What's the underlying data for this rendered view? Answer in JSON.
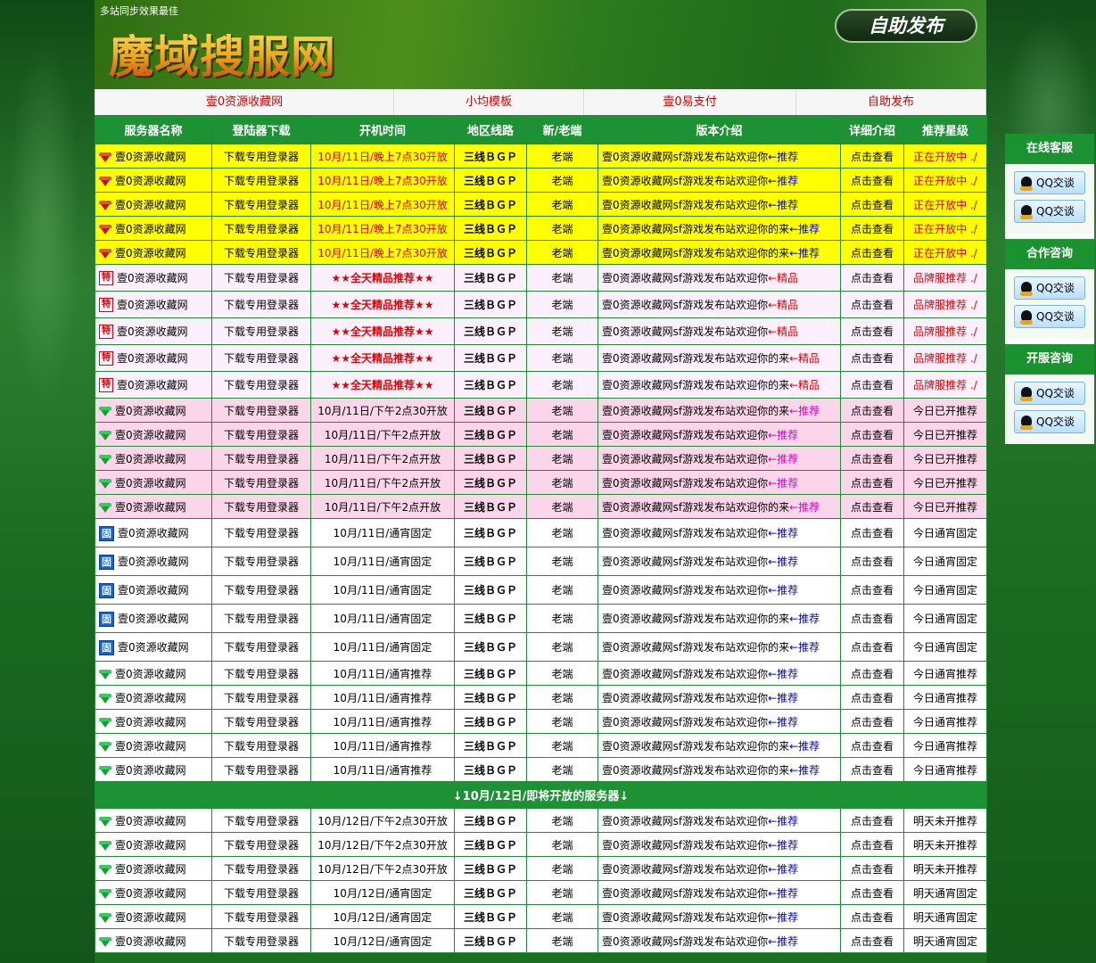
{
  "header": {
    "tagline": "多站同步效果最佳",
    "logo": "魔域搜服网",
    "publish_button": "自助发布"
  },
  "nav": [
    "壹0资源收藏网",
    "小均模板",
    "壹0易支付",
    "自助发布"
  ],
  "table": {
    "headers": [
      "服务器名称",
      "登陆器下载",
      "开机时间",
      "地区线路",
      "新/老端",
      "版本介绍",
      "详细介绍",
      "推荐星级"
    ],
    "rows": [
      {
        "style": "yellow",
        "icon": "gem-red",
        "name": "壹0资源收藏网",
        "download": "下载专用登录器",
        "time": "10月/11日/晚上7点30开放",
        "line": "三线ＢＧＰ",
        "type": "老端",
        "intro": "壹0资源收藏网sf游戏发布站欢迎你",
        "tag": "←推荐",
        "detail": "点击查看",
        "star": "正在开放中 ./"
      },
      {
        "style": "yellow",
        "icon": "gem-red",
        "name": "壹0资源收藏网",
        "download": "下载专用登录器",
        "time": "10月/11日/晚上7点30开放",
        "line": "三线ＢＧＰ",
        "type": "老端",
        "intro": "壹0资源收藏网sf游戏发布站欢迎你",
        "tag": "←推荐",
        "detail": "点击查看",
        "star": "正在开放中 ./"
      },
      {
        "style": "yellow",
        "icon": "gem-red",
        "name": "壹0资源收藏网",
        "download": "下载专用登录器",
        "time": "10月/11日/晚上7点30开放",
        "line": "三线ＢＧＰ",
        "type": "老端",
        "intro": "壹0资源收藏网sf游戏发布站欢迎你",
        "tag": "←推荐",
        "detail": "点击查看",
        "star": "正在开放中 ./"
      },
      {
        "style": "yellow",
        "icon": "gem-red",
        "name": "壹0资源收藏网",
        "download": "下载专用登录器",
        "time": "10月/11日/晚上7点30开放",
        "line": "三线ＢＧＰ",
        "type": "老端",
        "intro": "壹0资源收藏网sf游戏发布站欢迎你的来",
        "tag": "←推荐",
        "detail": "点击查看",
        "star": "正在开放中 ./"
      },
      {
        "style": "yellow",
        "icon": "gem-red",
        "name": "壹0资源收藏网",
        "download": "下载专用登录器",
        "time": "10月/11日/晚上7点30开放",
        "line": "三线ＢＧＰ",
        "type": "老端",
        "intro": "壹0资源收藏网sf游戏发布站欢迎你的来",
        "tag": "←推荐",
        "detail": "点击查看",
        "star": "正在开放中 ./"
      },
      {
        "style": "lav",
        "icon": "box",
        "name": "壹0资源收藏网",
        "download": "下载专用登录器",
        "time": "★★全天精品推荐★★",
        "line": "三线ＢＧＰ",
        "type": "老端",
        "intro": "壹0资源收藏网sf游戏发布站欢迎你",
        "tag": "←精品",
        "detail": "点击查看",
        "star": "品牌服推荐 ./"
      },
      {
        "style": "lav",
        "icon": "box",
        "name": "壹0资源收藏网",
        "download": "下载专用登录器",
        "time": "★★全天精品推荐★★",
        "line": "三线ＢＧＰ",
        "type": "老端",
        "intro": "壹0资源收藏网sf游戏发布站欢迎你",
        "tag": "←精品",
        "detail": "点击查看",
        "star": "品牌服推荐 ./"
      },
      {
        "style": "lav",
        "icon": "box",
        "name": "壹0资源收藏网",
        "download": "下载专用登录器",
        "time": "★★全天精品推荐★★",
        "line": "三线ＢＧＰ",
        "type": "老端",
        "intro": "壹0资源收藏网sf游戏发布站欢迎你",
        "tag": "←精品",
        "detail": "点击查看",
        "star": "品牌服推荐 ./"
      },
      {
        "style": "lav",
        "icon": "box",
        "name": "壹0资源收藏网",
        "download": "下载专用登录器",
        "time": "★★全天精品推荐★★",
        "line": "三线ＢＧＰ",
        "type": "老端",
        "intro": "壹0资源收藏网sf游戏发布站欢迎你的来",
        "tag": "←精品",
        "detail": "点击查看",
        "star": "品牌服推荐 ./"
      },
      {
        "style": "lav",
        "icon": "box",
        "name": "壹0资源收藏网",
        "download": "下载专用登录器",
        "time": "★★全天精品推荐★★",
        "line": "三线ＢＧＰ",
        "type": "老端",
        "intro": "壹0资源收藏网sf游戏发布站欢迎你的来",
        "tag": "←精品",
        "detail": "点击查看",
        "star": "品牌服推荐 ./"
      },
      {
        "style": "pink",
        "icon": "gem-green",
        "name": "壹0资源收藏网",
        "download": "下载专用登录器",
        "time": "10月/11日/下午2点30开放",
        "line": "三线ＢＧＰ",
        "type": "老端",
        "intro": "壹0资源收藏网sf游戏发布站欢迎你的来",
        "tag": "←推荐",
        "detail": "点击查看",
        "star": "今日已开推荐"
      },
      {
        "style": "pink",
        "icon": "gem-green",
        "name": "壹0资源收藏网",
        "download": "下载专用登录器",
        "time": "10月/11日/下午2点开放",
        "line": "三线ＢＧＰ",
        "type": "老端",
        "intro": "壹0资源收藏网sf游戏发布站欢迎你",
        "tag": "←推荐",
        "detail": "点击查看",
        "star": "今日已开推荐"
      },
      {
        "style": "pink",
        "icon": "gem-green",
        "name": "壹0资源收藏网",
        "download": "下载专用登录器",
        "time": "10月/11日/下午2点开放",
        "line": "三线ＢＧＰ",
        "type": "老端",
        "intro": "壹0资源收藏网sf游戏发布站欢迎你",
        "tag": "←推荐",
        "detail": "点击查看",
        "star": "今日已开推荐"
      },
      {
        "style": "pink",
        "icon": "gem-green",
        "name": "壹0资源收藏网",
        "download": "下载专用登录器",
        "time": "10月/11日/下午2点开放",
        "line": "三线ＢＧＰ",
        "type": "老端",
        "intro": "壹0资源收藏网sf游戏发布站欢迎你",
        "tag": "←推荐",
        "detail": "点击查看",
        "star": "今日已开推荐"
      },
      {
        "style": "pink",
        "icon": "gem-green",
        "name": "壹0资源收藏网",
        "download": "下载专用登录器",
        "time": "10月/11日/下午2点开放",
        "line": "三线ＢＧＰ",
        "type": "老端",
        "intro": "壹0资源收藏网sf游戏发布站欢迎你的来",
        "tag": "←推荐",
        "detail": "点击查看",
        "star": "今日已开推荐"
      },
      {
        "style": "white-tall",
        "icon": "blue",
        "name": "壹0资源收藏网",
        "download": "下载专用登录器",
        "time": "10月/11日/通宵固定",
        "line": "三线ＢＧＰ",
        "type": "老端",
        "intro": "壹0资源收藏网sf游戏发布站欢迎你",
        "tag": "←推荐",
        "detail": "点击查看",
        "star": "今日通宵固定"
      },
      {
        "style": "white-tall",
        "icon": "blue",
        "name": "壹0资源收藏网",
        "download": "下载专用登录器",
        "time": "10月/11日/通宵固定",
        "line": "三线ＢＧＰ",
        "type": "老端",
        "intro": "壹0资源收藏网sf游戏发布站欢迎你",
        "tag": "←推荐",
        "detail": "点击查看",
        "star": "今日通宵固定"
      },
      {
        "style": "white-tall",
        "icon": "blue",
        "name": "壹0资源收藏网",
        "download": "下载专用登录器",
        "time": "10月/11日/通宵固定",
        "line": "三线ＢＧＰ",
        "type": "老端",
        "intro": "壹0资源收藏网sf游戏发布站欢迎你",
        "tag": "←推荐",
        "detail": "点击查看",
        "star": "今日通宵固定"
      },
      {
        "style": "white-tall",
        "icon": "blue",
        "name": "壹0资源收藏网",
        "download": "下载专用登录器",
        "time": "10月/11日/通宵固定",
        "line": "三线ＢＧＰ",
        "type": "老端",
        "intro": "壹0资源收藏网sf游戏发布站欢迎你的来",
        "tag": "←推荐",
        "detail": "点击查看",
        "star": "今日通宵固定"
      },
      {
        "style": "white-tall",
        "icon": "blue",
        "name": "壹0资源收藏网",
        "download": "下载专用登录器",
        "time": "10月/11日/通宵固定",
        "line": "三线ＢＧＰ",
        "type": "老端",
        "intro": "壹0资源收藏网sf游戏发布站欢迎你的来",
        "tag": "←推荐",
        "detail": "点击查看",
        "star": "今日通宵固定"
      },
      {
        "style": "white",
        "icon": "gem-green",
        "name": "壹0资源收藏网",
        "download": "下载专用登录器",
        "time": "10月/11日/通宵推荐",
        "line": "三线ＢＧＰ",
        "type": "老端",
        "intro": "壹0资源收藏网sf游戏发布站欢迎你",
        "tag": "←推荐",
        "detail": "点击查看",
        "star": "今日通宵推荐"
      },
      {
        "style": "white",
        "icon": "gem-green",
        "name": "壹0资源收藏网",
        "download": "下载专用登录器",
        "time": "10月/11日/通宵推荐",
        "line": "三线ＢＧＰ",
        "type": "老端",
        "intro": "壹0资源收藏网sf游戏发布站欢迎你",
        "tag": "←推荐",
        "detail": "点击查看",
        "star": "今日通宵推荐"
      },
      {
        "style": "white",
        "icon": "gem-green",
        "name": "壹0资源收藏网",
        "download": "下载专用登录器",
        "time": "10月/11日/通宵推荐",
        "line": "三线ＢＧＰ",
        "type": "老端",
        "intro": "壹0资源收藏网sf游戏发布站欢迎你",
        "tag": "←推荐",
        "detail": "点击查看",
        "star": "今日通宵推荐"
      },
      {
        "style": "white",
        "icon": "gem-green",
        "name": "壹0资源收藏网",
        "download": "下载专用登录器",
        "time": "10月/11日/通宵推荐",
        "line": "三线ＢＧＰ",
        "type": "老端",
        "intro": "壹0资源收藏网sf游戏发布站欢迎你的来",
        "tag": "←推荐",
        "detail": "点击查看",
        "star": "今日通宵推荐"
      },
      {
        "style": "white",
        "icon": "gem-green",
        "name": "壹0资源收藏网",
        "download": "下载专用登录器",
        "time": "10月/11日/通宵推荐",
        "line": "三线ＢＧＰ",
        "type": "老端",
        "intro": "壹0资源收藏网sf游戏发布站欢迎你的来",
        "tag": "←推荐",
        "detail": "点击查看",
        "star": "今日通宵推荐"
      }
    ],
    "separator": "↓10月/12日/即将开放的服务器↓",
    "rows2": [
      {
        "style": "white",
        "icon": "gem-green",
        "name": "壹0资源收藏网",
        "download": "下载专用登录器",
        "time": "10月/12日/下午2点30开放",
        "line": "三线ＢＧＰ",
        "type": "老端",
        "intro": "壹0资源收藏网sf游戏发布站欢迎你",
        "tag": "←推荐",
        "detail": "点击查看",
        "star": "明天未开推荐"
      },
      {
        "style": "white",
        "icon": "gem-green",
        "name": "壹0资源收藏网",
        "download": "下载专用登录器",
        "time": "10月/12日/下午2点30开放",
        "line": "三线ＢＧＰ",
        "type": "老端",
        "intro": "壹0资源收藏网sf游戏发布站欢迎你",
        "tag": "←推荐",
        "detail": "点击查看",
        "star": "明天未开推荐"
      },
      {
        "style": "white",
        "icon": "gem-green",
        "name": "壹0资源收藏网",
        "download": "下载专用登录器",
        "time": "10月/12日/下午2点30开放",
        "line": "三线ＢＧＰ",
        "type": "老端",
        "intro": "壹0资源收藏网sf游戏发布站欢迎你",
        "tag": "←推荐",
        "detail": "点击查看",
        "star": "明天未开推荐"
      },
      {
        "style": "white",
        "icon": "gem-green",
        "name": "壹0资源收藏网",
        "download": "下载专用登录器",
        "time": "10月/12日/通宵固定",
        "line": "三线ＢＧＰ",
        "type": "老端",
        "intro": "壹0资源收藏网sf游戏发布站欢迎你",
        "tag": "←推荐",
        "detail": "点击查看",
        "star": "明天通宵固定"
      },
      {
        "style": "white",
        "icon": "gem-green",
        "name": "壹0资源收藏网",
        "download": "下载专用登录器",
        "time": "10月/12日/通宵固定",
        "line": "三线ＢＧＰ",
        "type": "老端",
        "intro": "壹0资源收藏网sf游戏发布站欢迎你",
        "tag": "←推荐",
        "detail": "点击查看",
        "star": "明天通宵固定"
      },
      {
        "style": "white",
        "icon": "gem-green",
        "name": "壹0资源收藏网",
        "download": "下载专用登录器",
        "time": "10月/12日/通宵固定",
        "line": "三线ＢＧＰ",
        "type": "老端",
        "intro": "壹0资源收藏网sf游戏发布站欢迎你",
        "tag": "←推荐",
        "detail": "点击查看",
        "star": "明天通宵固定"
      }
    ]
  },
  "sidebar": {
    "sections": [
      {
        "title": "在线客服",
        "buttons": [
          "QQ交谈",
          "QQ交谈"
        ]
      },
      {
        "title": "合作咨询",
        "buttons": [
          "QQ交谈",
          "QQ交谈"
        ]
      },
      {
        "title": "开服咨询",
        "buttons": [
          "QQ交谈",
          "QQ交谈"
        ]
      }
    ]
  },
  "colors": {
    "header_green": "#1d9234",
    "yellow_row": "#ffff00",
    "lavender_row": "#fdf0fe",
    "pink_row": "#fbd6ea",
    "red_text": "#e30000",
    "blue_link": "#0000d8"
  }
}
